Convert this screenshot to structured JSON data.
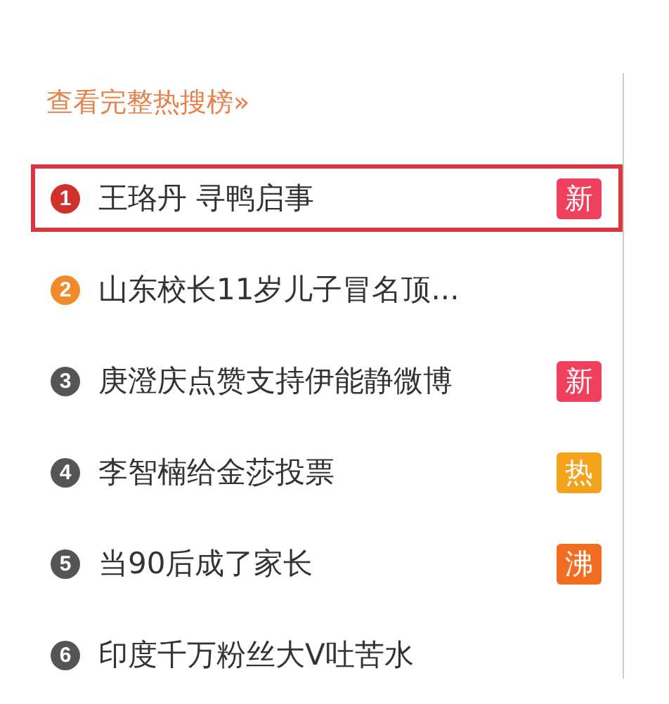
{
  "link": "查看完整热搜榜»",
  "items": [
    {
      "rank": "1",
      "color": "#d0312d",
      "title": "王珞丹 寻鸭启事",
      "selected": true,
      "badge": {
        "text": "新",
        "color": "#f0405d"
      }
    },
    {
      "rank": "2",
      "color": "#f08a2c",
      "title": "山东校长11岁儿子冒名顶...",
      "selected": false
    },
    {
      "rank": "3",
      "color": "#555555",
      "title": "庚澄庆点赞支持伊能静微博",
      "selected": false,
      "badge": {
        "text": "新",
        "color": "#f0405d"
      }
    },
    {
      "rank": "4",
      "color": "#555555",
      "title": "李智楠给金莎投票",
      "selected": false,
      "badge": {
        "text": "热",
        "color": "#f5a21c"
      }
    },
    {
      "rank": "5",
      "color": "#555555",
      "title": "当90后成了家长",
      "selected": false,
      "badge": {
        "text": "沸",
        "color": "#f26d1f"
      }
    },
    {
      "rank": "6",
      "color": "#555555",
      "title": "印度千万粉丝大V吐苦水",
      "selected": false
    }
  ]
}
